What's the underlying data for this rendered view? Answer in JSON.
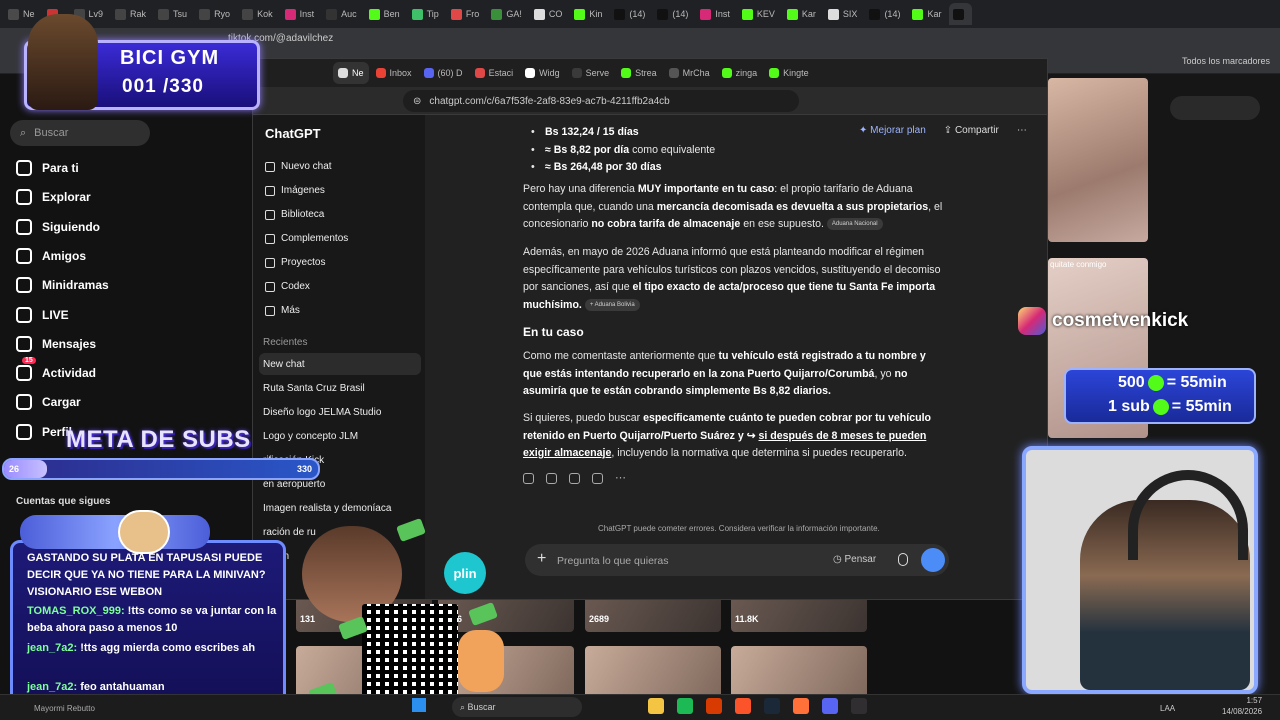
{
  "outer_browser": {
    "tabs": [
      {
        "label": "Ne",
        "color": "#4a4a4a"
      },
      {
        "label": "",
        "color": "#cc3333"
      },
      {
        "label": "Lv9",
        "color": "#444"
      },
      {
        "label": "Rak",
        "color": "#444"
      },
      {
        "label": "Tsu",
        "color": "#444"
      },
      {
        "label": "Ryo",
        "color": "#444"
      },
      {
        "label": "Kok",
        "color": "#444"
      },
      {
        "label": "Inst",
        "color": "#d62976"
      },
      {
        "label": "Auc",
        "color": "#333"
      },
      {
        "label": "Ben",
        "color": "#53fc18"
      },
      {
        "label": "Tip",
        "color": "#3fbf6a"
      },
      {
        "label": "Fro",
        "color": "#e04848"
      },
      {
        "label": "GA!",
        "color": "#3a8f3a"
      },
      {
        "label": "CO",
        "color": "#ddd"
      },
      {
        "label": "Kin",
        "color": "#53fc18"
      },
      {
        "label": "(14)",
        "color": "#111"
      },
      {
        "label": "(14)",
        "color": "#111"
      },
      {
        "label": "Inst",
        "color": "#d62976"
      },
      {
        "label": "KEV",
        "color": "#53fc18"
      },
      {
        "label": "Kar",
        "color": "#53fc18"
      },
      {
        "label": "SIX",
        "color": "#ddd"
      },
      {
        "label": "(14)",
        "color": "#111"
      },
      {
        "label": "Kar",
        "color": "#53fc18"
      },
      {
        "label": "",
        "color": "#111"
      }
    ],
    "url": "tiktok.com/@adavilchez",
    "bookmarks_all": "Todos los marcadores"
  },
  "tiktok": {
    "search_placeholder": "Buscar",
    "nav": [
      {
        "label": "Para ti",
        "icon": "home-icon"
      },
      {
        "label": "Explorar",
        "icon": "compass-icon"
      },
      {
        "label": "Siguiendo",
        "icon": "following-icon"
      },
      {
        "label": "Amigos",
        "icon": "friends-icon"
      },
      {
        "label": "Minidramas",
        "icon": "minidramas-icon"
      },
      {
        "label": "LIVE",
        "icon": "live-icon"
      },
      {
        "label": "Mensajes",
        "icon": "messages-icon"
      },
      {
        "label": "Actividad",
        "icon": "activity-icon"
      },
      {
        "label": "Cargar",
        "icon": "upload-icon"
      },
      {
        "label": "Perfil",
        "icon": "profile-icon"
      }
    ],
    "activity_badge": "15",
    "followed_heading": "Cuentas que sigues",
    "video_counts": [
      "131",
      "3136",
      "2689",
      "11.8K"
    ],
    "thumb_text_cam2": "quitate conmigo"
  },
  "chatgpt_window": {
    "tabs": [
      {
        "label": "Ne",
        "color": "#ddd",
        "active": true
      },
      {
        "label": "Inbox",
        "color": "#ea4335"
      },
      {
        "label": "(60) D",
        "color": "#5865f2"
      },
      {
        "label": "Estaci",
        "color": "#e04848"
      },
      {
        "label": "Widg",
        "color": "#fff"
      },
      {
        "label": "Serve",
        "color": "#3a3a3a"
      },
      {
        "label": "Strea",
        "color": "#53fc18"
      },
      {
        "label": "MrCha",
        "color": "#555"
      },
      {
        "label": "zinga",
        "color": "#53fc18"
      },
      {
        "label": "Kingte",
        "color": "#53fc18"
      }
    ],
    "url": "chatgpt.com/c/6a7f53fe-2af8-83e9-ac7b-4211ffb2a4cb",
    "brand": "ChatGPT",
    "menu": [
      {
        "label": "Nuevo chat",
        "icon": "new-chat-icon"
      },
      {
        "label": "Imágenes",
        "icon": "images-icon"
      },
      {
        "label": "Biblioteca",
        "icon": "library-icon"
      },
      {
        "label": "Complementos",
        "icon": "plugins-icon"
      },
      {
        "label": "Proyectos",
        "icon": "projects-icon"
      },
      {
        "label": "Codex",
        "icon": "codex-icon"
      },
      {
        "label": "Más",
        "icon": "more-icon"
      }
    ],
    "recientes_label": "Recientes",
    "recent_chats": [
      "New chat",
      "Ruta Santa Cruz Brasil",
      "Diseño logo JELMA Studio",
      "Logo y concepto JLM",
      "rificación Kick",
      "en aeropuerto",
      "Imagen realista y demoníaca",
      "ración de ru",
      "Cosm"
    ],
    "top_buttons": {
      "upgrade": "Mejorar plan",
      "share": "Compartir"
    },
    "answer": {
      "bullets": [
        {
          "bold": "Bs 132,24 / 15 días",
          "rest": ""
        },
        {
          "bold": "≈ Bs 8,82 por día",
          "rest": " como equivalente"
        },
        {
          "bold": "≈ Bs 264,48 por 30 días",
          "rest": ""
        }
      ],
      "p1": {
        "t1": "Pero hay una diferencia ",
        "b1": "MUY importante en tu caso",
        "t2": ": el propio tarifario de Aduana contempla que, cuando una ",
        "b2": "mercancía decomisada es devuelta a sus propietarios",
        "t3": ", el concesionario ",
        "b3": "no cobra tarifa de almacenaje",
        "t4": " en ese supuesto.",
        "chip": "Aduana Nacional"
      },
      "p2": {
        "t1": "Además, en mayo de 2026 Aduana informó que está planteando modificar el régimen específicamente para vehículos turísticos con plazos vencidos, sustituyendo el decomiso por sanciones, así que ",
        "b1": "el tipo exacto de acta/proceso que tiene tu Santa Fe importa muchísimo.",
        "chip": "+ Aduana Bolivia"
      },
      "heading": "En tu caso",
      "p3": {
        "t1": "Como me comentaste anteriormente que ",
        "b1": "tu vehículo está registrado a tu nombre y que estás intentando recuperarlo en la zona Puerto Quijarro/Corumbá",
        "t2": ", yo ",
        "b2": "no asumiría que te están cobrando simplemente Bs 8,82 diarios."
      },
      "p4": {
        "t1": "Si quieres, puedo buscar ",
        "b1": "específicamente cuánto te pueden cobrar por tu vehículo retenido en Puerto Quijarro/Puerto Suárez y ↪ ",
        "b2": "si después de 8 meses te pueden exigir almacenaje",
        "t2": ", incluyendo la normativa que determina si puedes recuperarlo."
      }
    },
    "disclaimer": "ChatGPT puede cometer errores. Considera verificar la información importante.",
    "composer_placeholder": "Pregunta lo que quieras",
    "think_label": "Pensar"
  },
  "overlays": {
    "gym_title": "BICI GYM",
    "gym_count": "001 /330",
    "meta_title": "META DE SUBS",
    "meta_current": "26",
    "meta_max": "330",
    "meta_progress": 0.079,
    "chat_messages": [
      {
        "user": "",
        "text": "GASTANDO SU PLATA EN TAPUSASI PUEDE DECIR QUE YA NO TIENE PARA LA MINIVAN? VISIONARIO ESE WEBON"
      },
      {
        "user": "TOMAS_ROX_999:",
        "text": " !tts como se va juntar con la beba ahora paso a menos 10"
      },
      {
        "user": "jean_7a2:",
        "text": " !tts agg mierda como escribes ah"
      },
      {
        "user": "jean_7a2:",
        "text": " feo antahuaman"
      }
    ],
    "plin": "plin",
    "instagram_handle": "cosmetvenkick",
    "promo_1": {
      "left": "500",
      "right": "= 55min"
    },
    "promo_2": {
      "left": "1 sub",
      "right": "= 55min"
    }
  },
  "taskbar": {
    "search": "Buscar",
    "lang": "LAA",
    "time": "1:57",
    "date": "14/08/2026",
    "user": "Mayormi Rebutto",
    "apps": [
      {
        "name": "files",
        "color": "#f4c542"
      },
      {
        "name": "spotify",
        "color": "#1db954"
      },
      {
        "name": "office",
        "color": "#d83b01"
      },
      {
        "name": "brave",
        "color": "#fb542b"
      },
      {
        "name": "steam",
        "color": "#1b2838"
      },
      {
        "name": "firefox",
        "color": "#ff7139"
      },
      {
        "name": "discord",
        "color": "#5865f2"
      },
      {
        "name": "obs",
        "color": "#302e31"
      }
    ]
  }
}
